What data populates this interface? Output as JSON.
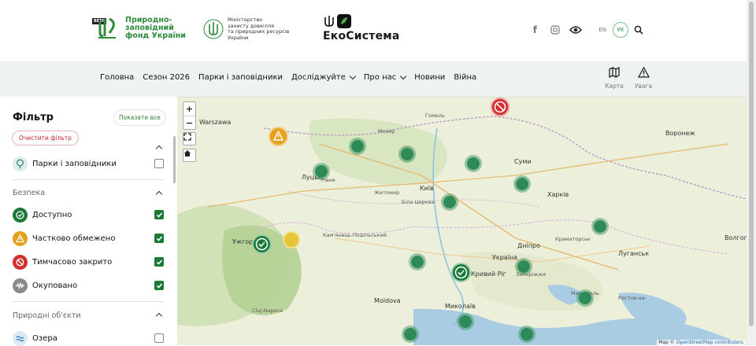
{
  "header": {
    "beta_badge": "BETA",
    "pzf_name_line1": "Природно-",
    "pzf_name_line2": "заповідний",
    "pzf_name_line3": "фонд України",
    "ministry_line1": "Міністерство",
    "ministry_line2": "захисту довкілля",
    "ministry_line3": "та природних ресурсів",
    "ministry_line4": "України",
    "eco_title": "ЕкоСистема",
    "lang_en": "EN",
    "lang_uk": "УК",
    "icons": [
      "facebook-icon",
      "instagram-icon",
      "eye-icon",
      "search-icon"
    ]
  },
  "nav": {
    "items": [
      {
        "label": "Головна"
      },
      {
        "label": "Сезон 2026"
      },
      {
        "label": "Парки і заповідники"
      },
      {
        "label": "Досліджуйте",
        "dropdown": true
      },
      {
        "label": "Про нас",
        "dropdown": true
      },
      {
        "label": "Новини"
      },
      {
        "label": "Війна"
      }
    ],
    "map_label": "Карта",
    "warning_label": "Увага"
  },
  "sidebar": {
    "title": "Фільтр",
    "show_all": "Показати все",
    "clear": "Очистити фільтр",
    "parks_label": "Парки і заповідники",
    "parks_checked": false,
    "security_title": "Безпека",
    "security": [
      {
        "label": "Доступно",
        "checked": true,
        "color": "#1b7a3a"
      },
      {
        "label": "Частково обмежено",
        "checked": true,
        "color": "#e6a020"
      },
      {
        "label": "Тимчасово закрито",
        "checked": true,
        "color": "#d32f2f"
      },
      {
        "label": "Окуповано",
        "checked": true,
        "color": "#8a8a8a"
      }
    ],
    "nature_title": "Природні об'єкти",
    "nature": [
      {
        "label": "Озера",
        "checked": false
      }
    ]
  },
  "map": {
    "attribution_prefix": "Map © ",
    "attribution_link": "OpenStreetMap contributors",
    "labels": {
      "warszawa": "Warszawa",
      "gomel": "Гомель",
      "voronezh": "Воронеж",
      "sumy": "Суми",
      "kyiv": "Київ",
      "kharkiv": "Харків",
      "lutsk": "Луцьк",
      "rivne": "Рівне",
      "zhytomyr": "Житомир",
      "bila_tserkva": "Біла Церква",
      "kryvyi_rih": "Кривий Ріг",
      "dnipro": "Дніпро",
      "zaporizhzhia": "Запоріжжя",
      "luhansk": "Луганськ",
      "volgograd": "Волгоград",
      "ukraina": "Україна",
      "moldova": "Moldova",
      "mykolaiv": "Миколаїв",
      "uzhhorod": "Ужгород",
      "cluj": "Cluj-Napoca",
      "kramatorsk": "Краматорськ",
      "rostov": "Ростов-на-",
      "mariupol": "Маріуполь",
      "kamianets": "Кам'янець-Подільський",
      "mozyr": "Мозир"
    }
  }
}
